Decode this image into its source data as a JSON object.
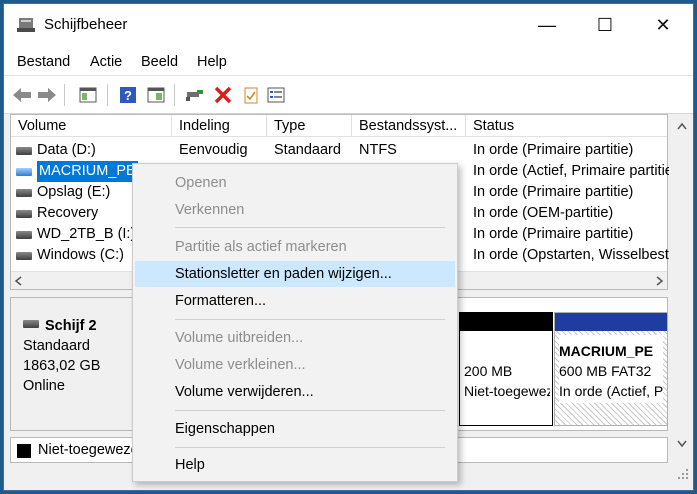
{
  "window": {
    "title": "Schijfbeheer"
  },
  "controls": {
    "minimize": "—",
    "maximize": "☐",
    "close": "✕"
  },
  "menu": [
    "Bestand",
    "Actie",
    "Beeld",
    "Help"
  ],
  "toolbar": {
    "icons": [
      "back-arrow-icon",
      "forward-arrow-icon",
      "console-tree-icon",
      "help-icon",
      "properties-icon",
      "connect-icon",
      "delete-icon",
      "checklist-icon",
      "list-view-icon"
    ],
    "delete_color": "#d81e1e"
  },
  "volume_table": {
    "headers": [
      "Volume",
      "Indeling",
      "Type",
      "Bestandssyst...",
      "Status"
    ],
    "rows": [
      {
        "volume": "Data (D:)",
        "indeling": "Eenvoudig",
        "type": "Standaard",
        "fs": "NTFS",
        "status": "In orde (Primaire partitie)"
      },
      {
        "volume": "MACRIUM_PE",
        "indeling": "",
        "type": "",
        "fs": "",
        "status": "In orde (Actief, Primaire partitie)"
      },
      {
        "volume": "Opslag (E:)",
        "indeling": "",
        "type": "",
        "fs": "",
        "status": "In orde (Primaire partitie)"
      },
      {
        "volume": "Recovery",
        "indeling": "",
        "type": "",
        "fs": "",
        "status": "In orde (OEM-partitie)"
      },
      {
        "volume": "WD_2TB_B (I:)",
        "indeling": "",
        "type": "",
        "fs": "",
        "status": "In orde (Primaire partitie)"
      },
      {
        "volume": "Windows (C:)",
        "indeling": "",
        "type": "",
        "fs": "",
        "status": "In orde (Opstarten, Wisselbestand, Crashdump, Primaire partitie)"
      }
    ]
  },
  "disk": {
    "name": "Schijf 2",
    "kind": "Standaard",
    "size": "1863,02 GB",
    "state": "Online",
    "partitions": [
      {
        "size": "200 MB",
        "status": "Niet-toegewezen"
      },
      {
        "name": "MACRIUM_PE",
        "size": "600 MB FAT32",
        "status": "In orde (Actief, Primaire partitie)"
      }
    ]
  },
  "legend": {
    "label": "Niet-toegewezen"
  },
  "context_menu": {
    "items": [
      {
        "label": "Openen",
        "disabled": true
      },
      {
        "label": "Verkennen",
        "disabled": true
      },
      {
        "label": "Partitie als actief markeren",
        "disabled": true
      },
      {
        "label": "Stationsletter en paden wijzigen...",
        "disabled": false,
        "highlighted": true
      },
      {
        "label": "Formatteren...",
        "disabled": false
      },
      {
        "label": "Volume uitbreiden...",
        "disabled": true
      },
      {
        "label": "Volume verkleinen...",
        "disabled": true
      },
      {
        "label": "Volume verwijderen...",
        "disabled": false
      },
      {
        "label": "Eigenschappen",
        "disabled": false
      },
      {
        "label": "Help",
        "disabled": false
      }
    ]
  },
  "colors": {
    "selection": "#0078d7",
    "menu_highlight": "#cce8ff",
    "partition_primary": "#1f3d9e",
    "partition_unallocated": "#000000"
  }
}
